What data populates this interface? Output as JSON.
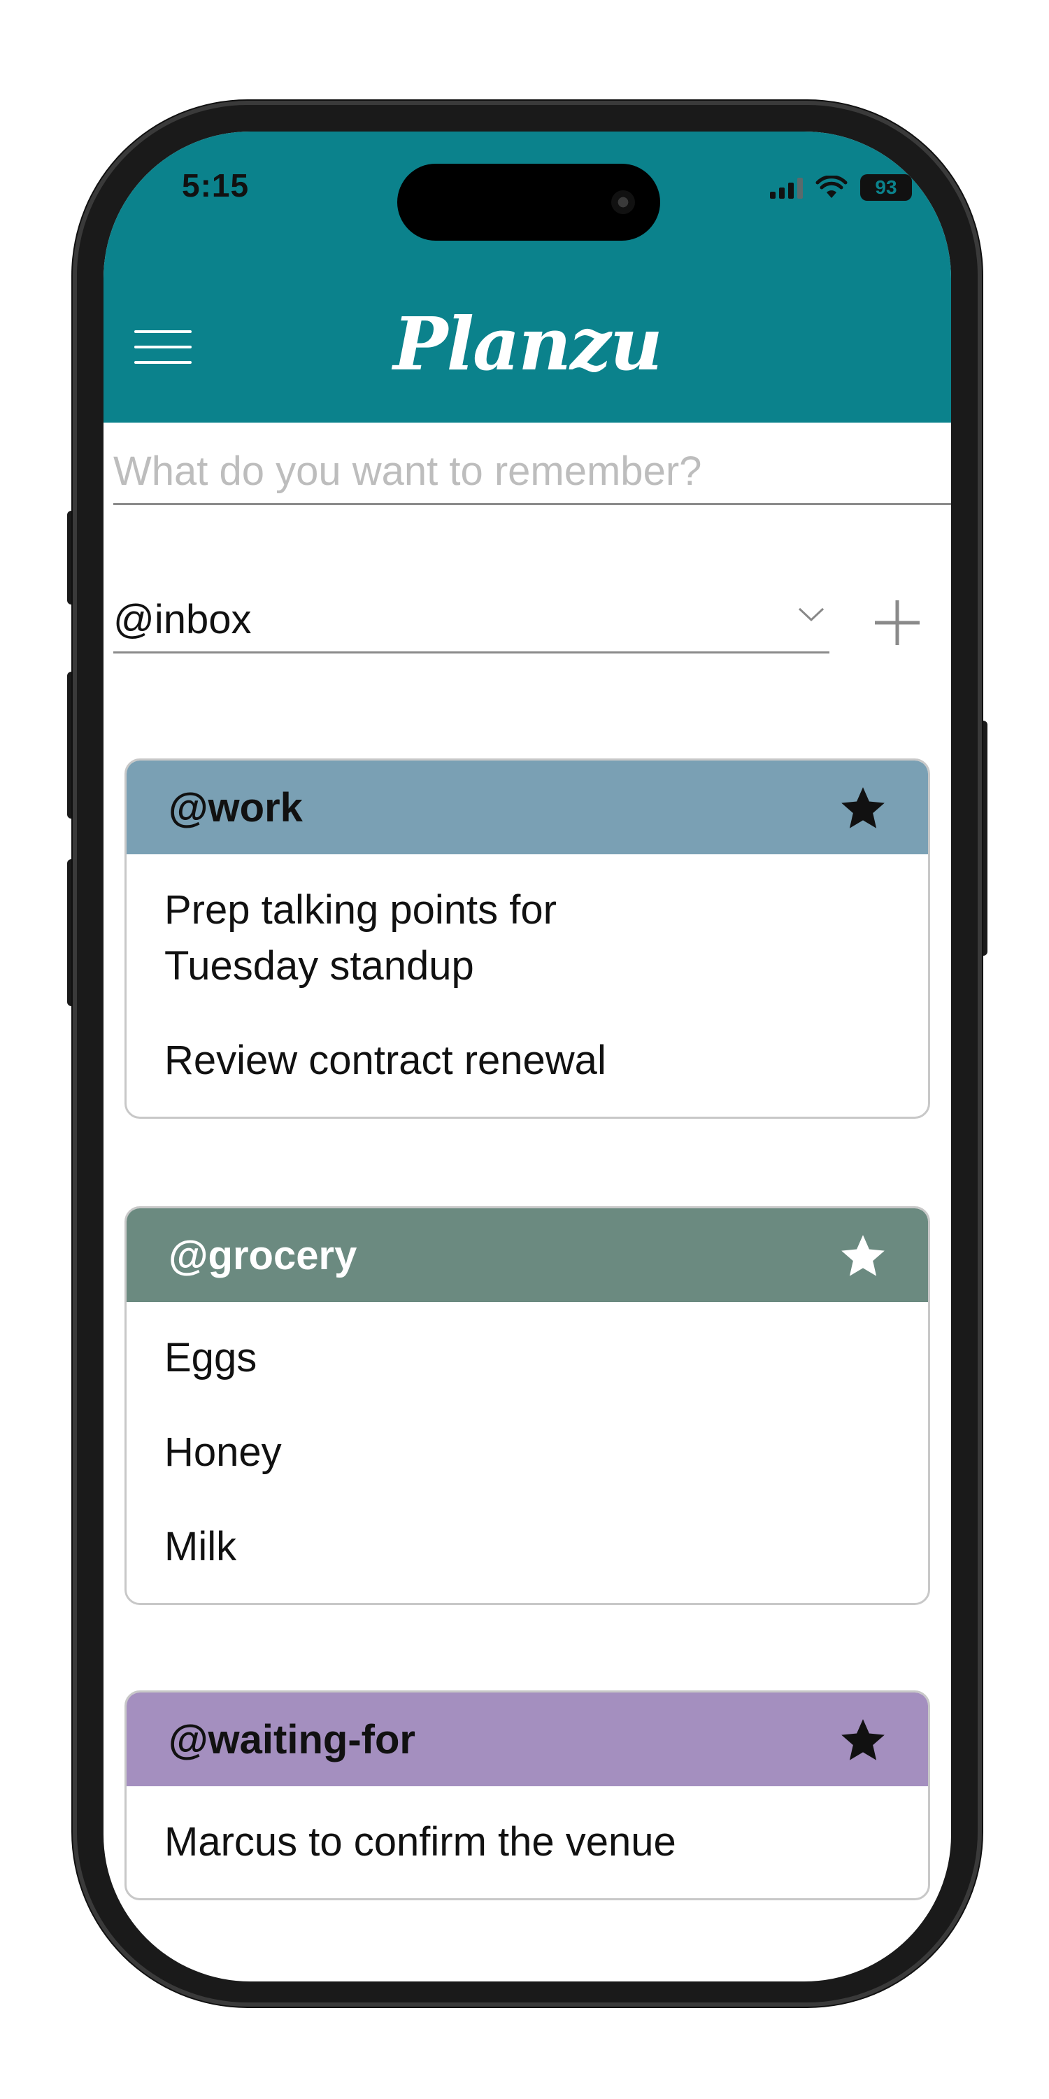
{
  "status_bar": {
    "time": "5:15",
    "battery": "93"
  },
  "header": {
    "title": "Planzu",
    "background_color": "#0b828c",
    "menu_icon": "hamburger-menu-icon"
  },
  "note_input": {
    "value": "",
    "placeholder": "What do you want to remember?"
  },
  "context_select": {
    "selected": "@inbox",
    "icon": "chevron-down-icon"
  },
  "add_button": {
    "icon": "plus-icon"
  },
  "cards": [
    {
      "title": "@work",
      "header_color": "#7aa0b4",
      "title_color": "#111111",
      "star_color": "#111111",
      "items": [
        "Prep talking points for Tuesday standup",
        "Review contract renewal"
      ]
    },
    {
      "title": "@grocery",
      "header_color": "#6b8a80",
      "title_color": "#ffffff",
      "star_color": "#ffffff",
      "items": [
        "Eggs",
        "Honey",
        "Milk"
      ]
    },
    {
      "title": "@waiting-for",
      "header_color": "#a48fbf",
      "title_color": "#111111",
      "star_color": "#111111",
      "items": [
        "Marcus to confirm the venue"
      ]
    }
  ]
}
